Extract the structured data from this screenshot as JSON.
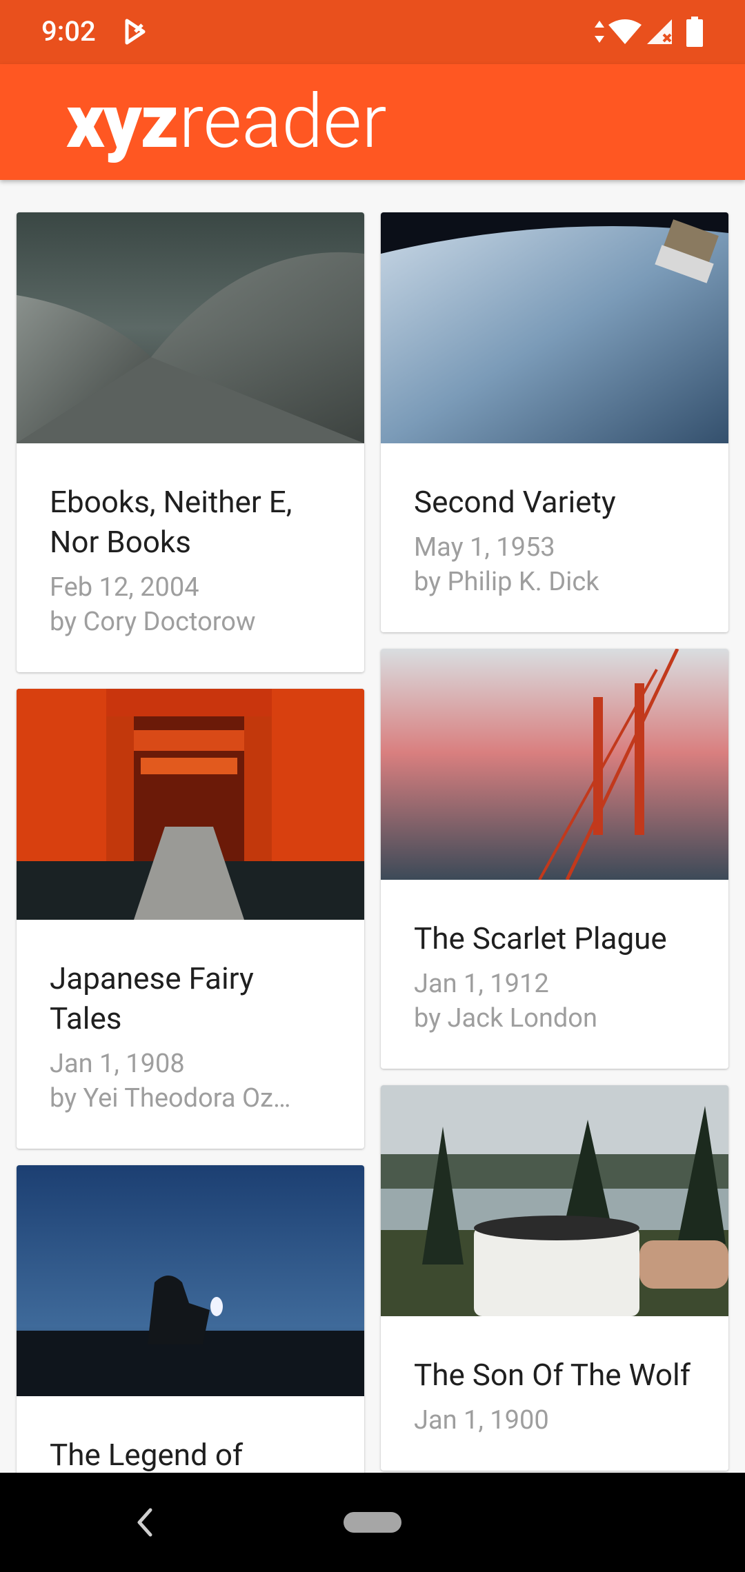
{
  "status": {
    "time": "9:02",
    "icons": [
      "play-store-icon",
      "data-arrows-icon",
      "wifi-icon",
      "signal-icon",
      "battery-icon"
    ]
  },
  "app": {
    "logo_bold": "xyz",
    "logo_light": "reader",
    "accent": "#ff5722"
  },
  "articles": [
    {
      "title": "Ebooks, Neither E, Nor Books",
      "date": "Feb 12, 2004",
      "author": "by Cory Doctorow",
      "image": "opera-house-roof-image"
    },
    {
      "title": "Second Variety",
      "date": "May 1, 1953",
      "author": "by Philip K. Dick",
      "image": "earth-from-space-image"
    },
    {
      "title": "Japanese Fairy Tales",
      "date": "Jan 1, 1908",
      "author": "by Yei Theodora Oz…",
      "image": "torii-gates-image"
    },
    {
      "title": "The Scarlet Plague",
      "date": "Jan 1, 1912",
      "author": "by Jack London",
      "image": "bridge-in-fog-image"
    },
    {
      "title": "The Legend of",
      "date": "",
      "author": "",
      "image": "lantern-silhouette-image"
    },
    {
      "title": "The Son Of The Wolf",
      "date": "Jan 1, 1900",
      "author": "",
      "image": "camping-mug-image"
    }
  ],
  "nav": {
    "icons": [
      "back-icon",
      "home-pill-icon"
    ]
  }
}
